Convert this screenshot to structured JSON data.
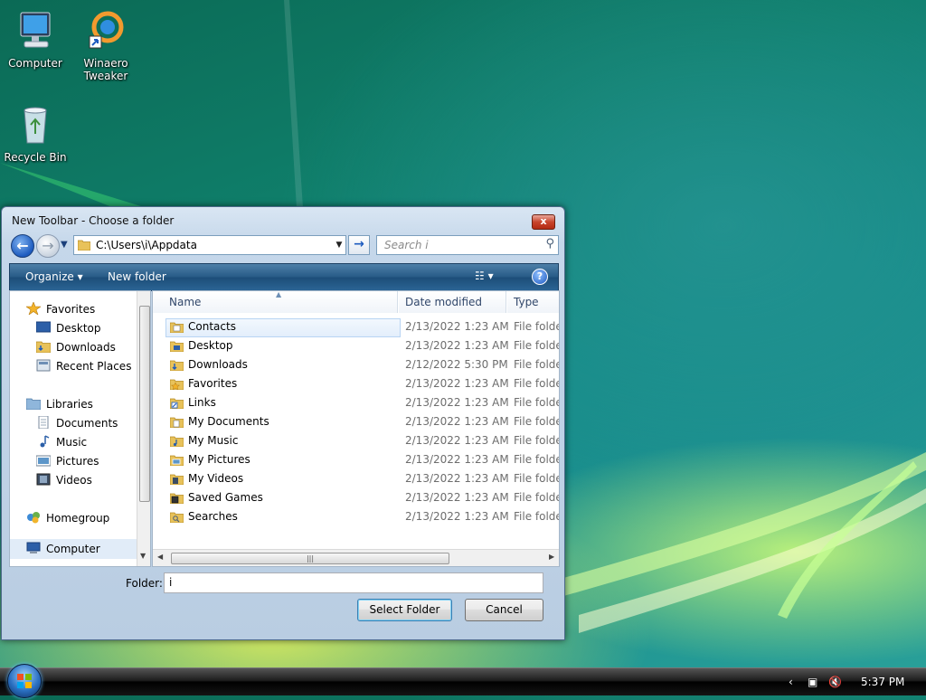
{
  "desktop": {
    "icons": [
      {
        "label_line1": "Computer",
        "label_line2": ""
      },
      {
        "label_line1": "Winaero",
        "label_line2": "Tweaker"
      },
      {
        "label_line1": "Recycle Bin",
        "label_line2": ""
      }
    ]
  },
  "dialog": {
    "title": "New Toolbar - Choose a folder",
    "close_label": "x",
    "address": "C:\\Users\\i\\Appdata",
    "search_placeholder": "Search i",
    "toolbar": {
      "organize": "Organize ▾",
      "new_folder": "New folder",
      "views": "☷ ▾",
      "help": "?"
    },
    "nav": {
      "favorites": {
        "label": "Favorites",
        "items": [
          "Desktop",
          "Downloads",
          "Recent Places"
        ]
      },
      "libraries": {
        "label": "Libraries",
        "items": [
          "Documents",
          "Music",
          "Pictures",
          "Videos"
        ]
      },
      "homegroup": "Homegroup",
      "computer": "Computer"
    },
    "columns": {
      "name": "Name",
      "date": "Date modified",
      "type": "Type"
    },
    "files": [
      {
        "name": "Contacts",
        "date": "2/13/2022 1:23 AM",
        "type": "File folder",
        "icon": "contacts-folder-icon"
      },
      {
        "name": "Desktop",
        "date": "2/13/2022 1:23 AM",
        "type": "File folder",
        "icon": "desktop-folder-icon"
      },
      {
        "name": "Downloads",
        "date": "2/12/2022 5:30 PM",
        "type": "File folder",
        "icon": "downloads-folder-icon"
      },
      {
        "name": "Favorites",
        "date": "2/13/2022 1:23 AM",
        "type": "File folder",
        "icon": "favorites-folder-icon"
      },
      {
        "name": "Links",
        "date": "2/13/2022 1:23 AM",
        "type": "File folder",
        "icon": "links-folder-icon"
      },
      {
        "name": "My Documents",
        "date": "2/13/2022 1:23 AM",
        "type": "File folder",
        "icon": "documents-folder-icon"
      },
      {
        "name": "My Music",
        "date": "2/13/2022 1:23 AM",
        "type": "File folder",
        "icon": "music-folder-icon"
      },
      {
        "name": "My Pictures",
        "date": "2/13/2022 1:23 AM",
        "type": "File folder",
        "icon": "pictures-folder-icon"
      },
      {
        "name": "My Videos",
        "date": "2/13/2022 1:23 AM",
        "type": "File folder",
        "icon": "videos-folder-icon"
      },
      {
        "name": "Saved Games",
        "date": "2/13/2022 1:23 AM",
        "type": "File folder",
        "icon": "saved-games-folder-icon"
      },
      {
        "name": "Searches",
        "date": "2/13/2022 1:23 AM",
        "type": "File folder",
        "icon": "searches-folder-icon"
      }
    ],
    "folder_label": "Folder:",
    "folder_value": "i",
    "select_button": "Select Folder",
    "cancel_button": "Cancel"
  },
  "taskbar": {
    "clock": "5:37 PM"
  },
  "colors": {
    "toolbar_blue": "#265a86",
    "folder_yellow": "#e8c25a",
    "close_red": "#c8452c"
  }
}
